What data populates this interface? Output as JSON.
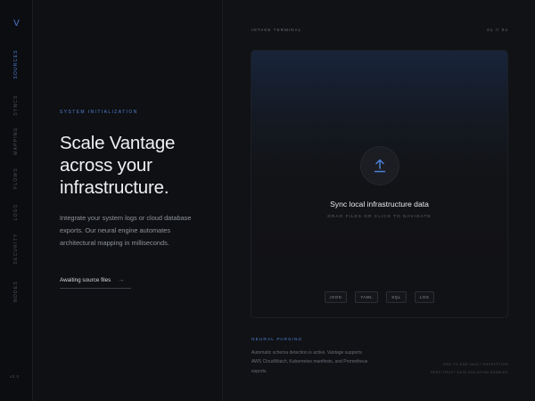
{
  "nav": {
    "logo": "V",
    "items": [
      {
        "label": "SOURCES",
        "active": true
      },
      {
        "label": "SYNCS",
        "active": false
      },
      {
        "label": "MAPPING",
        "active": false
      },
      {
        "label": "FLOWS",
        "active": false
      },
      {
        "label": "LOGS",
        "active": false
      },
      {
        "label": "SECURITY",
        "active": false
      },
      {
        "label": "NODES",
        "active": false
      }
    ],
    "version": "v2.0"
  },
  "hero": {
    "eyebrow": "SYSTEM INITIALIZATION",
    "headline": "Scale Vantage across your infrastructure.",
    "description": "Integrate your system logs or cloud database exports. Our neural engine automates architectural mapping in milliseconds.",
    "status_label": "Awaiting source files",
    "status_icon": "arrow-right-icon"
  },
  "panel": {
    "title": "INTAKE TERMINAL",
    "step": "01 // 04",
    "dropzone": {
      "icon": "upload-icon",
      "title": "Sync local infrastructure data",
      "subtitle": "DRAG FILES OR CLICK TO NAVIGATE",
      "formats": [
        "JSON",
        "YAML",
        "SQL",
        "LOG"
      ]
    },
    "neural_parsing": {
      "label": "NEURAL PARSING",
      "text": "Automatic schema detection is active. Vantage supports AWS CloudWatch, Kubernetes manifests, and Prometheus exports."
    },
    "meta": [
      "END-TO-END VAULT ENCRYPTION",
      "ZERO-TRUST DATA ISOLATION ENABLED"
    ]
  },
  "colors": {
    "accent": "#4d7fd6",
    "background": "#0e0f12",
    "text_primary": "#eef0f3"
  }
}
